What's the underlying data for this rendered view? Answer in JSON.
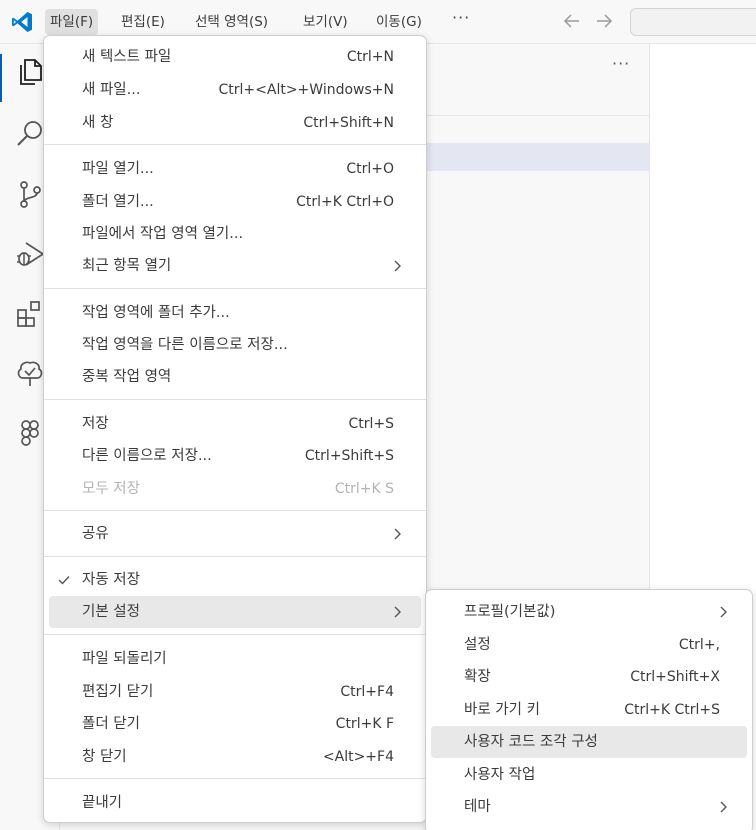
{
  "menubar": {
    "items": [
      "파일(F)",
      "편집(E)",
      "선택 영역(S)",
      "보기(V)",
      "이동(G)"
    ],
    "more": "···",
    "back_icon": "arrow-left-icon",
    "forward_icon": "arrow-right-icon"
  },
  "panel": {
    "more": "···"
  },
  "file_menu": {
    "new_text_file": {
      "label": "새 텍스트 파일",
      "key": "Ctrl+N"
    },
    "new_file": {
      "label": "새 파일...",
      "key": "Ctrl+<Alt>+Windows+N"
    },
    "new_window": {
      "label": "새 창",
      "key": "Ctrl+Shift+N"
    },
    "open_file": {
      "label": "파일 열기...",
      "key": "Ctrl+O"
    },
    "open_folder": {
      "label": "폴더 열기...",
      "key": "Ctrl+K Ctrl+O"
    },
    "open_workspace": {
      "label": "파일에서 작업 영역 열기..."
    },
    "open_recent": {
      "label": "최근 항목 열기"
    },
    "add_folder": {
      "label": "작업 영역에 폴더 추가..."
    },
    "save_workspace_as": {
      "label": "작업 영역을 다른 이름으로 저장..."
    },
    "duplicate_workspace": {
      "label": "중복 작업 영역"
    },
    "save": {
      "label": "저장",
      "key": "Ctrl+S"
    },
    "save_as": {
      "label": "다른 이름으로 저장...",
      "key": "Ctrl+Shift+S"
    },
    "save_all": {
      "label": "모두 저장",
      "key": "Ctrl+K S"
    },
    "share": {
      "label": "공유"
    },
    "auto_save": {
      "label": "자동 저장"
    },
    "preferences": {
      "label": "기본 설정"
    },
    "revert_file": {
      "label": "파일 되돌리기"
    },
    "close_editor": {
      "label": "편집기 닫기",
      "key": "Ctrl+F4"
    },
    "close_folder": {
      "label": "폴더 닫기",
      "key": "Ctrl+K F"
    },
    "close_window": {
      "label": "창 닫기",
      "key": "<Alt>+F4"
    },
    "exit": {
      "label": "끝내기"
    }
  },
  "pref_menu": {
    "profile": {
      "label": "프로필(기본값)"
    },
    "settings": {
      "label": "설정",
      "key": "Ctrl+,"
    },
    "extensions": {
      "label": "확장",
      "key": "Ctrl+Shift+X"
    },
    "keybindings": {
      "label": "바로 가기 키",
      "key": "Ctrl+K Ctrl+S"
    },
    "snippets": {
      "label": "사용자 코드 조각 구성"
    },
    "tasks": {
      "label": "사용자 작업"
    },
    "themes": {
      "label": "테마"
    }
  },
  "colors": {
    "accent": "#005fb8",
    "vscode_blue": "#007acc",
    "menu_selected": "#e8e8e8",
    "menubar_active": "#e0e0e0"
  }
}
